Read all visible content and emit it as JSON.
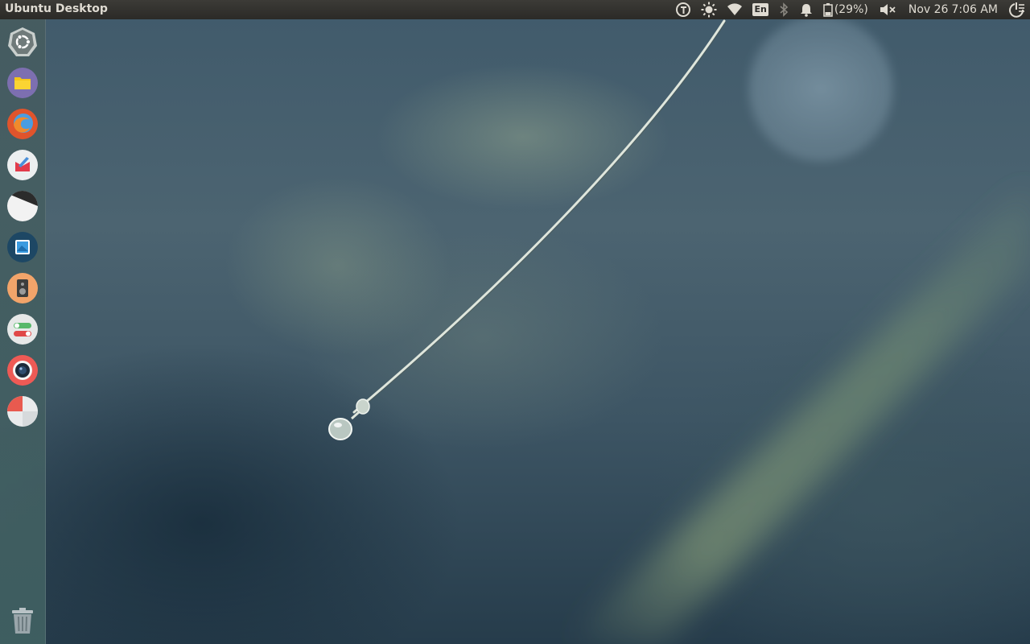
{
  "top_panel": {
    "title": "Ubuntu Desktop",
    "keyboard_layout": "En",
    "battery_percent": "(29%)",
    "date": "Nov 26",
    "time": "7:06 AM",
    "icons": [
      "update-indicator-icon",
      "brightness-icon",
      "wifi-icon",
      "keyboard-layout-icon",
      "bluetooth-icon",
      "notification-bell-icon",
      "battery-icon",
      "volume-muted-icon",
      "session-menu-icon"
    ]
  },
  "launcher": {
    "items": [
      {
        "icon": "dash-home-icon"
      },
      {
        "icon": "files-icon"
      },
      {
        "icon": "firefox-icon"
      },
      {
        "icon": "text-editor-icon"
      },
      {
        "icon": "app-half-circle-icon"
      },
      {
        "icon": "image-viewer-icon"
      },
      {
        "icon": "speaker-app-icon"
      },
      {
        "icon": "system-settings-toggles-icon"
      },
      {
        "icon": "camera-icon"
      },
      {
        "icon": "pie-chart-app-icon"
      }
    ],
    "trash_icon": "trash-icon"
  },
  "colors": {
    "panel_background": "#2b2a27",
    "panel_text": "#dfdbd2",
    "launcher_background": "#456064"
  }
}
